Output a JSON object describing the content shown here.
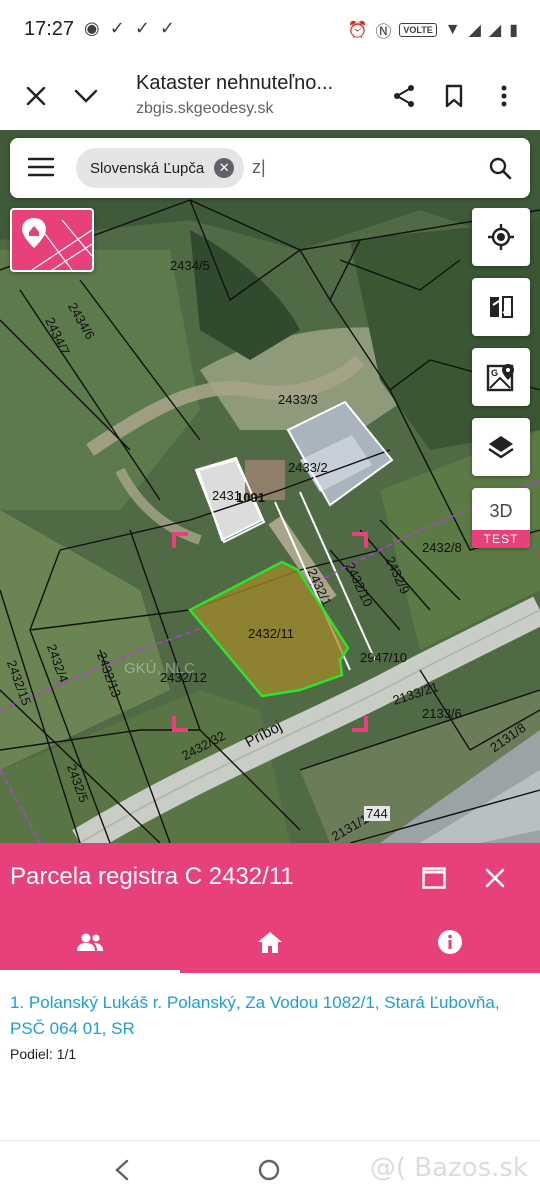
{
  "status": {
    "time": "17:27",
    "volte": "VOLTE"
  },
  "browser": {
    "title": "Kataster nehnuteľno...",
    "url": "zbgis.skgeodesy.sk"
  },
  "search": {
    "chip_label": "Slovenská Ľupča",
    "query": "z|"
  },
  "map": {
    "parcels": [
      "2434/5",
      "2434/6",
      "2434/7",
      "2433/3",
      "2433/2",
      "2431",
      "1091",
      "2432/8",
      "2432/1",
      "2432/10",
      "2432/9",
      "2432/11",
      "2432/12",
      "2947/10",
      "2133/21",
      "2133/6",
      "2131/8",
      "2432/4",
      "2432/15",
      "2432/13",
      "2432/32",
      "2432/5",
      "2131/1",
      "744"
    ],
    "road_label": "Príboj",
    "watermark": "GKÚ, NLC",
    "btn_3d": "3D",
    "btn_test": "TEST"
  },
  "panel": {
    "title": "Parcela registra C 2432/11",
    "owner": "1. Polanský Lukáš r. Polanský, Za Vodou 1082/1, Stará Ľubovňa, PSČ 064 01, SR",
    "share": "Podiel: 1/1"
  },
  "watermark": "@( Bazos.sk",
  "colors": {
    "accent": "#e8407a",
    "link": "#1a9fd9",
    "selected_parcel": "#2ee32e"
  }
}
